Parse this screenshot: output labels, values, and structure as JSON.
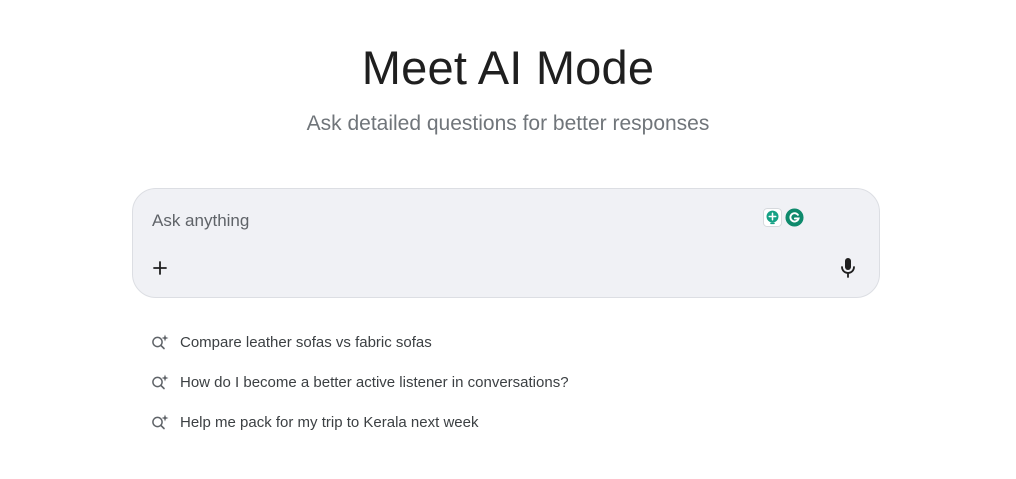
{
  "header": {
    "title": "Meet AI Mode",
    "subtitle": "Ask detailed questions for better responses"
  },
  "search": {
    "placeholder": "Ask anything",
    "value": "",
    "extension_icons": [
      "bulb-extension-icon",
      "grammarly-icon"
    ],
    "add_icon": "plus-icon",
    "voice_icon": "mic-icon"
  },
  "suggestions": [
    {
      "icon": "sparkle-search-icon",
      "label": "Compare leather sofas vs fabric sofas"
    },
    {
      "icon": "sparkle-search-icon",
      "label": "How do I become a better active listener in conversations?"
    },
    {
      "icon": "sparkle-search-icon",
      "label": "Help me pack for my trip to Kerala next week"
    }
  ],
  "colors": {
    "title": "#1f1f1f",
    "subtitle": "#70757a",
    "search_background": "#f0f1f5",
    "extension_green": "#15a185",
    "grammarly_green": "#0e8a6c"
  }
}
